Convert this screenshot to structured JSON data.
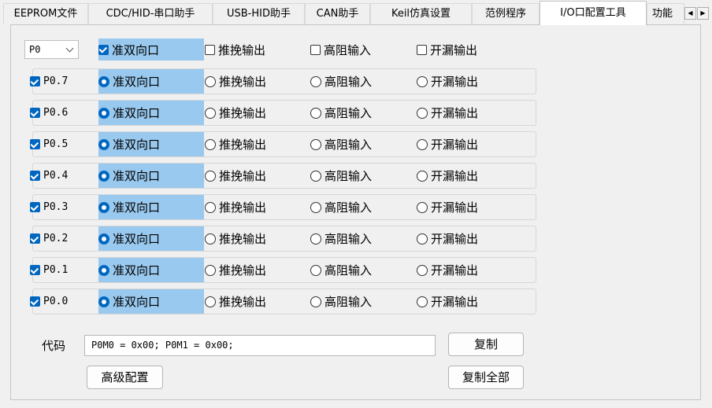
{
  "tabs": [
    {
      "label": "EEPROM文件",
      "active": false
    },
    {
      "label": "CDC/HID-串口助手",
      "active": false
    },
    {
      "label": "USB-HID助手",
      "active": false
    },
    {
      "label": "CAN助手",
      "active": false
    },
    {
      "label": "Keil仿真设置",
      "active": false
    },
    {
      "label": "范例程序",
      "active": false
    },
    {
      "label": "I/O口配置工具",
      "active": true
    },
    {
      "label": "功能",
      "active": false
    }
  ],
  "tab_scroll": {
    "left": "◀",
    "right": "▶"
  },
  "port_select": {
    "value": "P0"
  },
  "header_row": {
    "all_checked": true,
    "options": [
      "准双向口",
      "推挽输出",
      "高阻输入",
      "开漏输出"
    ]
  },
  "pins": [
    {
      "label": "P0.7",
      "checked": true,
      "mode": "准双向口"
    },
    {
      "label": "P0.6",
      "checked": true,
      "mode": "准双向口"
    },
    {
      "label": "P0.5",
      "checked": true,
      "mode": "准双向口"
    },
    {
      "label": "P0.4",
      "checked": true,
      "mode": "准双向口"
    },
    {
      "label": "P0.3",
      "checked": true,
      "mode": "准双向口"
    },
    {
      "label": "P0.2",
      "checked": true,
      "mode": "准双向口"
    },
    {
      "label": "P0.1",
      "checked": true,
      "mode": "准双向口"
    },
    {
      "label": "P0.0",
      "checked": true,
      "mode": "准双向口"
    }
  ],
  "mode_options": [
    "准双向口",
    "推挽输出",
    "高阻输入",
    "开漏输出"
  ],
  "code": {
    "label": "代码",
    "value": "P0M0 = 0x00; P0M1 = 0x00;"
  },
  "buttons": {
    "copy": "复制",
    "copy_all": "复制全部",
    "advanced": "高级配置"
  },
  "colors": {
    "accent": "#0067c0",
    "selection_highlight": "#99c9ef",
    "background": "#f0f0f0"
  }
}
